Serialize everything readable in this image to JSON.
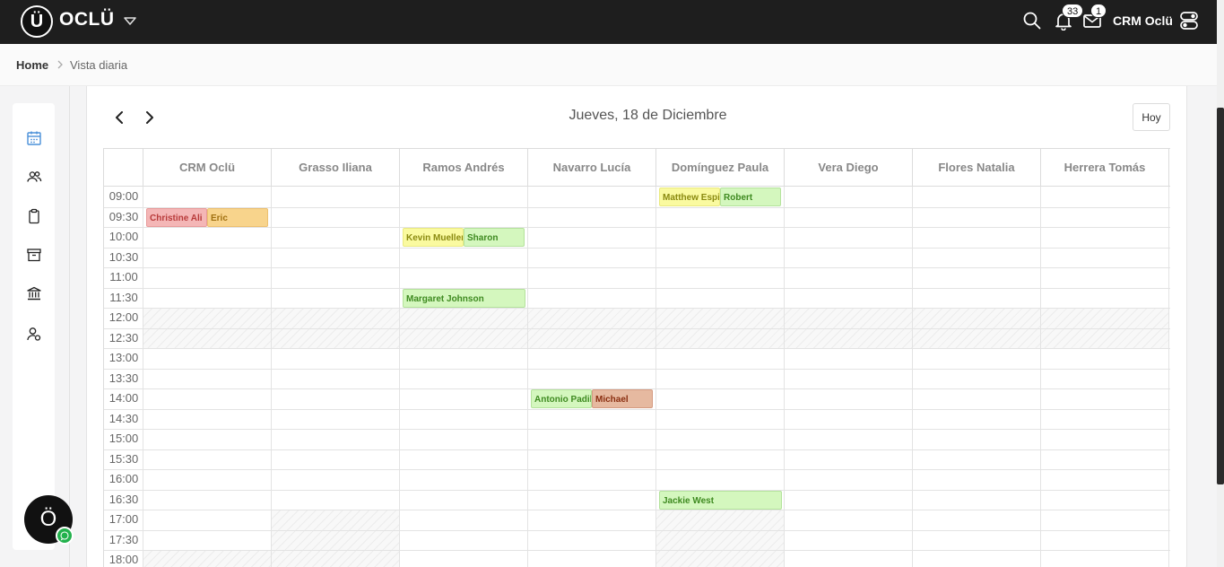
{
  "brand": {
    "logo_letter": "Ü",
    "name": "OCLÜ"
  },
  "topbar": {
    "notifications_count": "33",
    "messages_count": "1",
    "user_name": "CRM Oclü"
  },
  "breadcrumb": {
    "home": "Home",
    "current": "Vista diaria"
  },
  "calendar": {
    "title": "Jueves, 18 de Diciembre",
    "today_label": "Hoy",
    "columns": [
      "CRM Oclü",
      "Grasso Iliana",
      "Ramos Andrés",
      "Navarro Lucía",
      "Domínguez Paula",
      "Vera Diego",
      "Flores Natalia",
      "Herrera Tomás"
    ],
    "times": [
      "09:00",
      "09:30",
      "10:00",
      "10:30",
      "11:00",
      "11:30",
      "12:00",
      "12:30",
      "13:00",
      "13:30",
      "14:00",
      "14:30",
      "15:00",
      "15:30",
      "16:00",
      "16:30",
      "17:00",
      "17:30",
      "18:00"
    ],
    "events": [
      {
        "label": "Christine Ali",
        "column": 0,
        "time": "09:30",
        "half": 0,
        "bg": "#f4b6b6",
        "fg": "#b83a3a",
        "border": "#e89a9a"
      },
      {
        "label": "Eric",
        "column": 0,
        "time": "09:30",
        "half": 1,
        "bg": "#f8d48c",
        "fg": "#a07010",
        "border": "#ecc070"
      },
      {
        "label": "Kevin Mueller",
        "column": 2,
        "time": "10:00",
        "half": 0,
        "bg": "#fafaa0",
        "fg": "#8a8a10",
        "border": "#eaea80"
      },
      {
        "label": "Sharon",
        "column": 2,
        "time": "10:00",
        "half": 1,
        "bg": "#d4f7be",
        "fg": "#3e8a20",
        "border": "#b4e29c"
      },
      {
        "label": "Margaret Johnson",
        "column": 2,
        "time": "11:30",
        "half": -1,
        "bg": "#d4f7be",
        "fg": "#3e8a20",
        "border": "#b4e29c"
      },
      {
        "label": "Matthew Espinoza",
        "column": 4,
        "time": "09:00",
        "half": 0,
        "bg": "#fafaa0",
        "fg": "#8a8a10",
        "border": "#eaea80"
      },
      {
        "label": "Robert",
        "column": 4,
        "time": "09:00",
        "half": 1,
        "bg": "#d4f7be",
        "fg": "#3e8a20",
        "border": "#b4e29c"
      },
      {
        "label": "Antonio Padilla",
        "column": 3,
        "time": "14:00",
        "half": 0,
        "bg": "#d4f7be",
        "fg": "#3e8a20",
        "border": "#b4e29c"
      },
      {
        "label": "Michael",
        "column": 3,
        "time": "14:00",
        "half": 1,
        "bg": "#e6b9a0",
        "fg": "#8a2e10",
        "border": "#d49a80"
      },
      {
        "label": "Jackie West",
        "column": 4,
        "time": "16:30",
        "half": -1,
        "bg": "#d4f7be",
        "fg": "#3e8a20",
        "border": "#b4e29c"
      }
    ],
    "blocked": [
      {
        "column": "all",
        "from": "12:00",
        "to": "13:00"
      },
      {
        "column": 1,
        "from": "17:00",
        "to": "end"
      },
      {
        "column": 4,
        "from": "17:00",
        "to": "end"
      },
      {
        "column": 0,
        "from": "18:00",
        "to": "end"
      }
    ]
  },
  "chat": {
    "letter": "Ö"
  }
}
